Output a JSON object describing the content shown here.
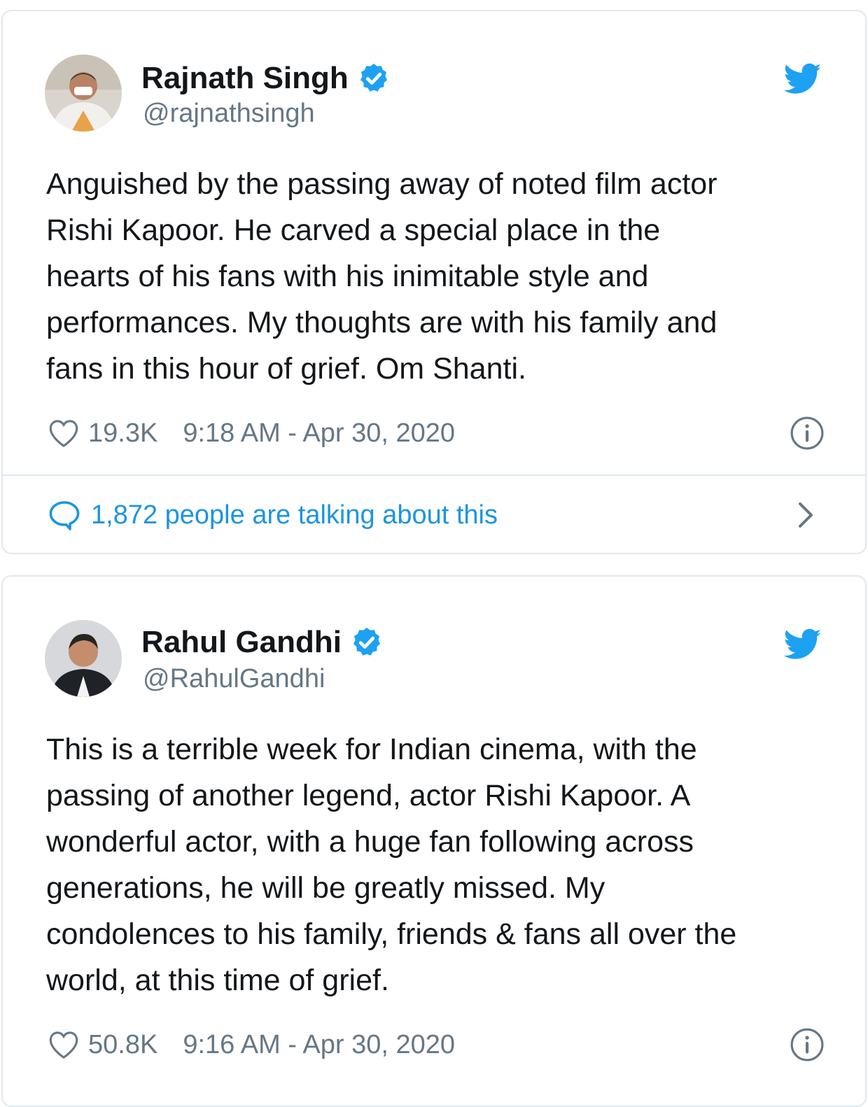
{
  "colors": {
    "text": "#14171a",
    "secondary": "#657786",
    "link": "#1b95e0",
    "border": "#e1e8ed",
    "verified": "#1da1f2"
  },
  "tweets": [
    {
      "name": "Rajnath Singh",
      "handle": "@rajnathsingh",
      "text": "Anguished by the passing away of noted film actor\nRishi Kapoor. He carved a special place in the\nhearts of his fans with his inimitable style and\nperformances. My thoughts are with his family and\nfans in this hour of grief. Om Shanti.",
      "likes": "19.3K",
      "timestamp": "9:18 AM - Apr 30, 2020",
      "conversation": "1,872 people are talking about this",
      "icons": [
        "verified-badge-icon",
        "twitter-bird-icon",
        "heart-icon",
        "info-icon",
        "reply-bubble-icon",
        "chevron-right-icon"
      ]
    },
    {
      "name": "Rahul Gandhi",
      "handle": "@RahulGandhi",
      "text": "This is a terrible week for Indian cinema, with the\npassing of another legend, actor Rishi Kapoor.  A\nwonderful actor, with a huge fan following across\ngenerations, he will be greatly missed. My\ncondolences to his family, friends & fans all over the\nworld, at this time of grief.",
      "likes": "50.8K",
      "timestamp": "9:16 AM - Apr 30, 2020",
      "icons": [
        "verified-badge-icon",
        "twitter-bird-icon",
        "heart-icon",
        "info-icon"
      ]
    }
  ]
}
